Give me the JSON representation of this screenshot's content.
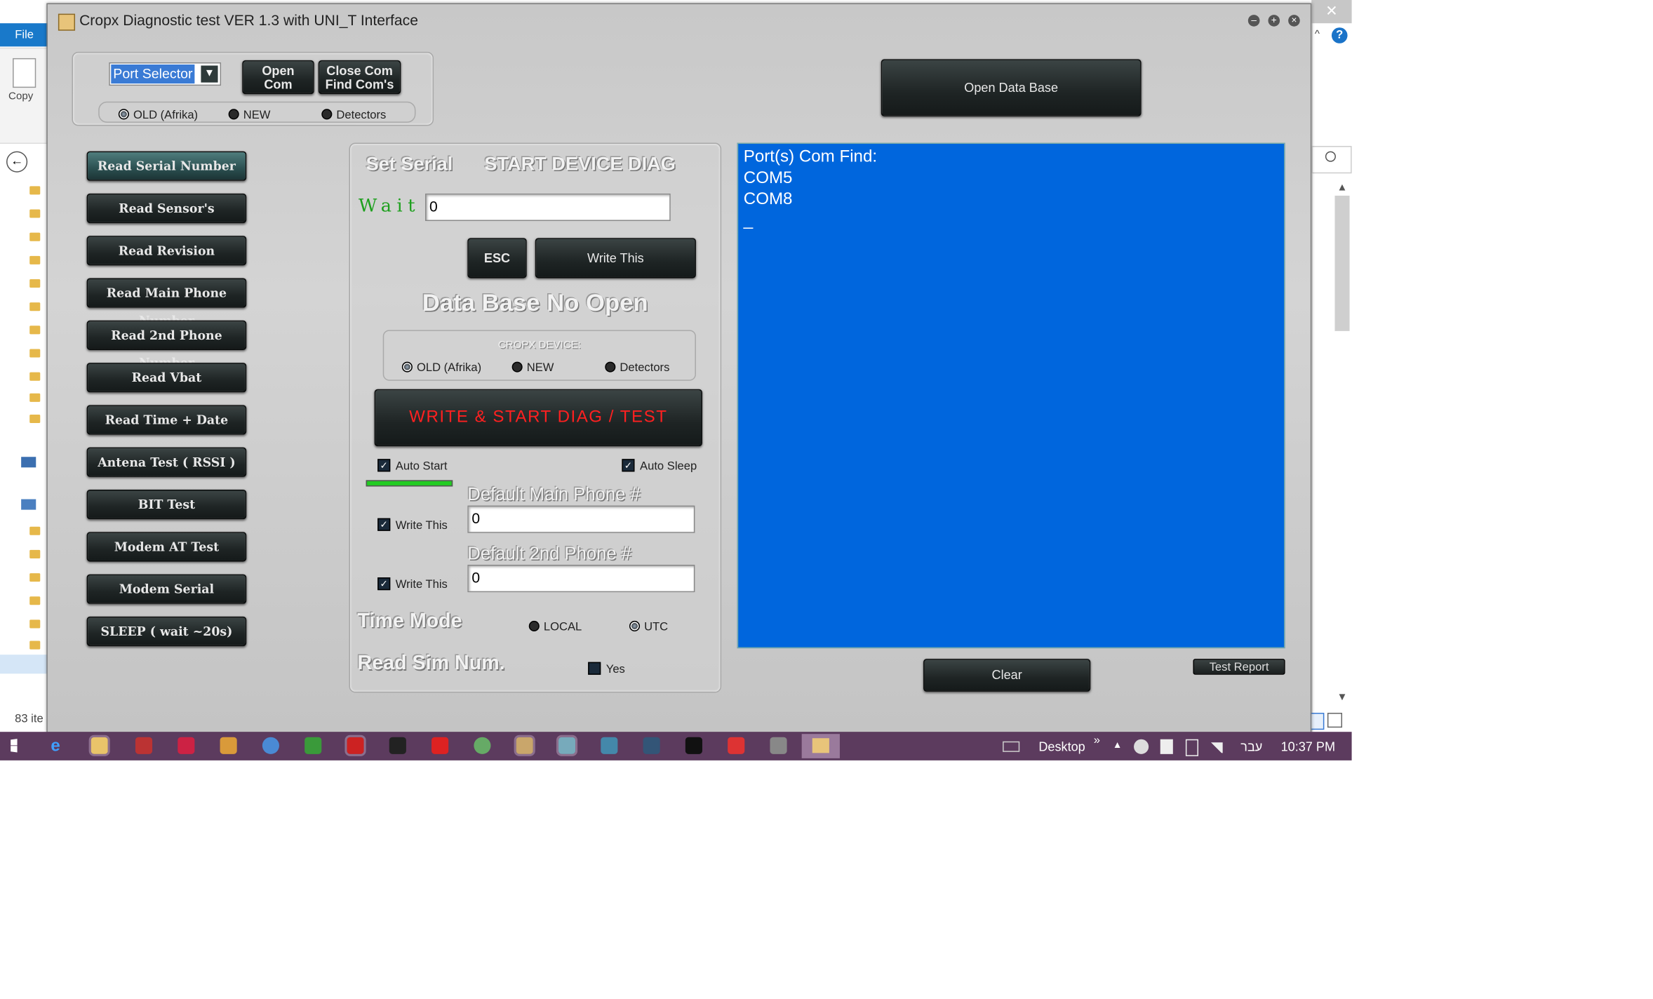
{
  "explorer": {
    "file_tab": "File",
    "copy_label": "Copy",
    "status": "83 ite",
    "close_glyph": "✕",
    "help_glyph": "?"
  },
  "window": {
    "title": "Cropx Diagnostic test VER 1.3 with UNI_T Interface",
    "controls": {
      "minimize": "–",
      "maximize": "+",
      "close": "×"
    }
  },
  "port_panel": {
    "port_selector": "Port Selector",
    "open_com": [
      "Open",
      "Com"
    ],
    "close_com": [
      "Close Com",
      "Find Com's"
    ],
    "radios": [
      {
        "label": "OLD (Afrika)",
        "on": true
      },
      {
        "label": "NEW",
        "on": false
      },
      {
        "label": "Detectors",
        "on": false
      }
    ]
  },
  "open_db_button": "Open Data Base",
  "left_buttons": [
    "Read Serial Number",
    "Read Sensor's",
    "Read Revision",
    "Read Main Phone Number",
    "Read 2nd Phone Number",
    "Read Vbat",
    "Read Time + Date",
    "Antena Test ( RSSI )",
    "BIT Test",
    "Modem AT Test",
    "Modem Serial",
    "SLEEP ( wait ~20s)"
  ],
  "center": {
    "set_serial": "Set Serial",
    "start_diag": "START DEVICE DIAG",
    "wait_label": "Wait",
    "wait_value": "0",
    "esc": "ESC",
    "write_this_btn": "Write This",
    "db_status": "Data Base No Open",
    "device_group": "CROPX DEVICE:",
    "device_radios": [
      {
        "label": "OLD (Afrika)",
        "on": true
      },
      {
        "label": "NEW",
        "on": false
      },
      {
        "label": "Detectors",
        "on": false
      }
    ],
    "write_start": "WRITE  &  START DIAG  / TEST",
    "auto_start": "Auto Start",
    "auto_sleep": "Auto Sleep",
    "default_main_phone": "Default Main Phone #",
    "default_2nd_phone": "Default 2nd Phone #",
    "write_this": "Write This",
    "main_phone_value": "0",
    "second_phone_value": "0",
    "time_mode": "Time Mode",
    "local": "LOCAL",
    "utc": "UTC",
    "read_sim": "Read Sim Num.",
    "yes": "Yes",
    "checkmark": "✓"
  },
  "console": {
    "lines": [
      "Port(s) Com Find:",
      "COM5",
      "COM8",
      "_"
    ]
  },
  "clear_button": "Clear",
  "test_report_button": "Test Report",
  "taskbar": {
    "desktop": "Desktop",
    "chevron": "»",
    "language": "עבר",
    "time": "10:37 PM"
  },
  "colors": {
    "console_bg": "#0066dd",
    "taskbar": "#5c3b5e",
    "write_start_text": "#ff2020",
    "progress": "#22cc22"
  }
}
